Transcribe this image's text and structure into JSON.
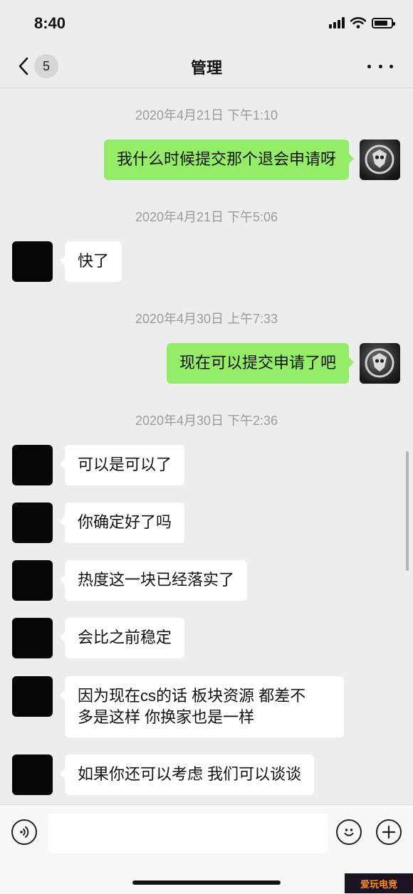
{
  "status_bar": {
    "time": "8:40"
  },
  "nav": {
    "back_count": "5",
    "title": "管理"
  },
  "messages": {
    "ts1": "2020年4月21日 下午1:10",
    "m1": "我什么时候提交那个退会申请呀",
    "ts2": "2020年4月21日 下午5:06",
    "m2": "快了",
    "ts3": "2020年4月30日 上午7:33",
    "m3": "现在可以提交申请了吧",
    "ts4": "2020年4月30日 下午2:36",
    "m4": "可以是可以了",
    "m5": "你确定好了吗",
    "m6": "热度这一块已经落实了",
    "m7": "会比之前稳定",
    "m8_line1": "因为现在cs的话 板块资源 都差不",
    "m8_line2": "多是这样 你换家也是一样",
    "m9": "如果你还可以考虑 我们可以谈谈"
  },
  "input_bar": {
    "value": "",
    "placeholder": ""
  },
  "watermark": "爱玩电竞",
  "colors": {
    "background": "#ededed",
    "outgoing_bubble": "#95ec69",
    "incoming_bubble": "#ffffff",
    "timestamp": "#9b9b9b"
  }
}
